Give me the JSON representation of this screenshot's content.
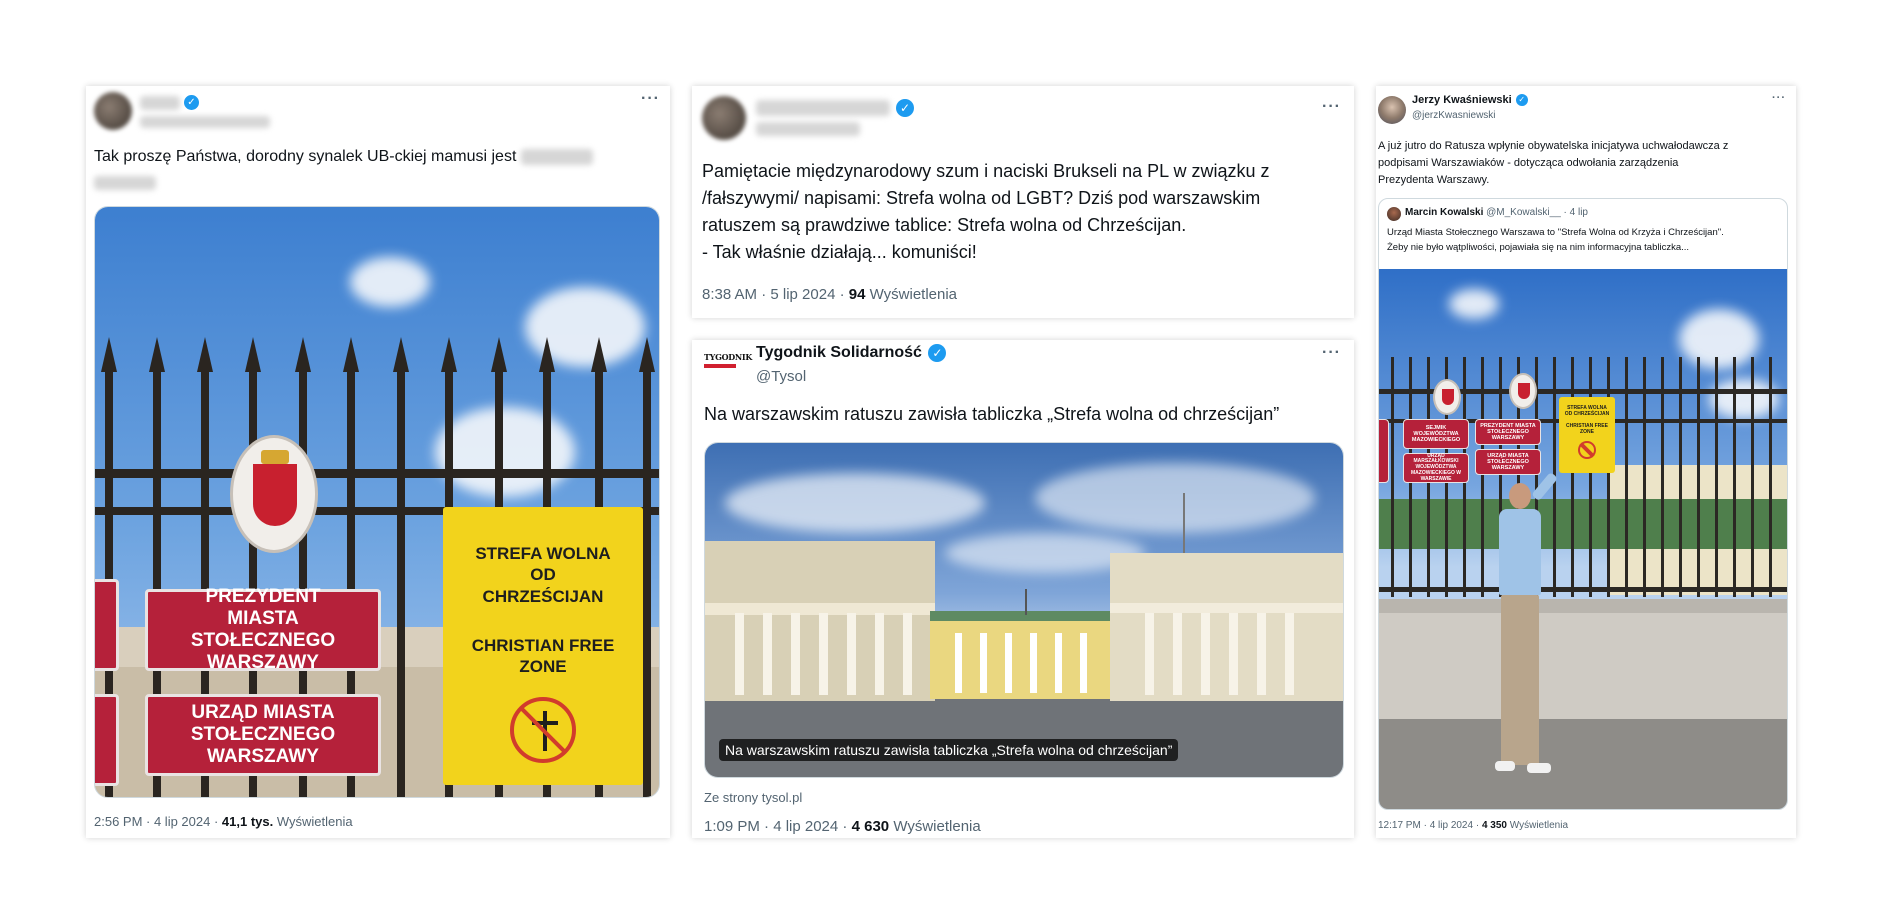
{
  "tweets": [
    {
      "more_label": "···",
      "text": "Tak proszę Państwa, dorodny synalek UB-ckiej mamusi jest",
      "sign_president": "PREZYDENT MIASTA STOŁECZNEGO WARSZAWY",
      "sign_office": "URZĄD MIASTA STOŁECZNEGO WARSZAWY",
      "sign_yellow_1": "STREFA WOLNA OD CHRZEŚCIJAN",
      "sign_yellow_2": "CHRISTIAN FREE ZONE",
      "time": "2:56 PM · 4 lip 2024 ·",
      "views_count": "41,1 tys.",
      "views_label": "Wyświetlenia"
    },
    {
      "more_label": "···",
      "text_lines": [
        "Pamiętacie międzynarodowy szum i naciski Brukseli na PL w związku z",
        "/fałszywymi/ napisami: Strefa wolna od LGBT? Dziś pod warszawskim",
        "ratuszem są prawdziwe tablice: Strefa wolna od Chrześcijan.",
        "- Tak właśnie działają... komuniści!"
      ],
      "time": "8:38 AM · 5 lip 2024 ·",
      "views_count": "94",
      "views_label": "Wyświetlenia"
    },
    {
      "author_name": "Tygodnik Solidarność",
      "handle": "@Tysol",
      "logo_text": "TYGODNIK",
      "more_label": "···",
      "text": "Na warszawskim ratuszu zawisła tabliczka „Strefa wolna od chrześcijan”",
      "image_caption": "Na warszawskim ratuszu zawisła tabliczka „Strefa wolna od chrześcijan”",
      "source": "Ze strony tysol.pl",
      "time": "1:09 PM · 4 lip 2024 ·",
      "views_count": "4 630",
      "views_label": "Wyświetlenia"
    },
    {
      "author_name": "Jerzy Kwaśniewski",
      "handle": "@jerzKwasniewski",
      "more_label": "···",
      "text_lines": [
        "A już jutro do Ratusza wpłynie obywatelska inicjatywa uchwałodawcza z",
        "podpisami Warszawiaków - dotycząca odwołania zarządzenia",
        "Prezydenta Warszawy."
      ],
      "quote": {
        "author_name": "Marcin Kowalski",
        "handle_time": "@M_Kowalski__ · 4 lip",
        "text_lines": [
          "Urząd Miasta Stołecznego Warszawa to \"Strefa Wolna od Krzyża i Chrześcijan\".",
          "Żeby nie było wątpliwości, pojawiała się na nim informacyjna tabliczka..."
        ]
      },
      "signs": {
        "sejmik": "SEJMIK WOJEWÓDZTWA MAZOWIECKIEGO",
        "urzad_marszalkowski": "URZĄD MARSZAŁKOWSKI WOJEWÓDZTWA MAZOWIECKIEGO W WARSZAWIE",
        "prezydent": "PREZYDENT MIASTA STOŁECZNEGO WARSZAWY",
        "urzad": "URZĄD MIASTA STOŁECZNEGO WARSZAWY",
        "yellow_1": "STREFA WOLNA OD CHRZEŚCIJAN",
        "yellow_2": "CHRISTIAN FREE ZONE"
      },
      "time": "12:17 PM · 4 lip 2024 ·",
      "views_count": "4 350",
      "views_label": "Wyświetlenia"
    }
  ],
  "colors": {
    "verified": "#1d9bf0",
    "sign_red": "#b5213a",
    "sign_yellow": "#f2d31c"
  }
}
